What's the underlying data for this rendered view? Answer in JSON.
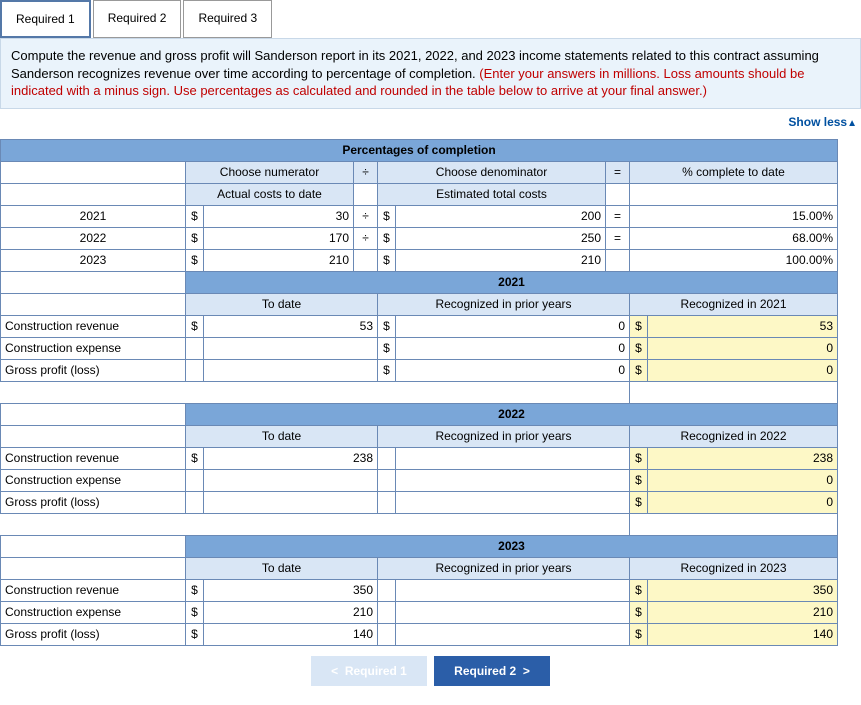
{
  "tabs": [
    "Required 1",
    "Required 2",
    "Required 3"
  ],
  "instructions": {
    "black": "Compute the revenue and gross profit will Sanderson report in its 2021, 2022, and 2023 income statements related to this contract assuming Sanderson recognizes revenue over time according to percentage of completion. ",
    "red": "(Enter your answers in millions. Loss amounts should be indicated with a minus sign. Use percentages as calculated and rounded in the table below to arrive at your final answer.)"
  },
  "showless": "Show less",
  "poc": {
    "title": "Percentages of completion",
    "h_num": "Choose numerator",
    "h_div": "÷",
    "h_denom": "Choose denominator",
    "h_eq": "=",
    "h_pct": "% complete to date",
    "sub_num": "Actual costs to date",
    "sub_denom": "Estimated total costs",
    "rows": [
      {
        "year": "2021",
        "num": "30",
        "div": "÷",
        "denom": "200",
        "eq": "=",
        "pct": "15.00%"
      },
      {
        "year": "2022",
        "num": "170",
        "div": "÷",
        "denom": "250",
        "eq": "=",
        "pct": "68.00%"
      },
      {
        "year": "2023",
        "num": "210",
        "div": "",
        "denom": "210",
        "eq": "",
        "pct": "100.00%"
      }
    ]
  },
  "labels": {
    "rev": "Construction revenue",
    "exp": "Construction expense",
    "gp": "Gross profit (loss)",
    "todate": "To date",
    "prior": "Recognized in prior years"
  },
  "y2021": {
    "title": "2021",
    "recog": "Recognized in 2021",
    "rev_td": "53",
    "rev_pr": "0",
    "rev_rc": "53",
    "exp_td": "",
    "exp_pr": "0",
    "exp_rc": "0",
    "gp_td": "",
    "gp_pr": "0",
    "gp_rc": "0"
  },
  "y2022": {
    "title": "2022",
    "recog": "Recognized in 2022",
    "rev_td": "238",
    "rev_pr": "",
    "rev_rc": "238",
    "exp_td": "",
    "exp_pr": "",
    "exp_rc": "0",
    "gp_td": "",
    "gp_pr": "",
    "gp_rc": "0"
  },
  "y2023": {
    "title": "2023",
    "recog": "Recognized in 2023",
    "rev_td": "350",
    "rev_pr": "",
    "rev_rc": "350",
    "exp_td": "210",
    "exp_pr": "",
    "exp_rc": "210",
    "gp_td": "140",
    "gp_pr": "",
    "gp_rc": "140"
  },
  "nav": {
    "prev": "Required 1",
    "next": "Required 2"
  },
  "sym": {
    "d": "$",
    "lt": "<",
    "gt": ">"
  }
}
